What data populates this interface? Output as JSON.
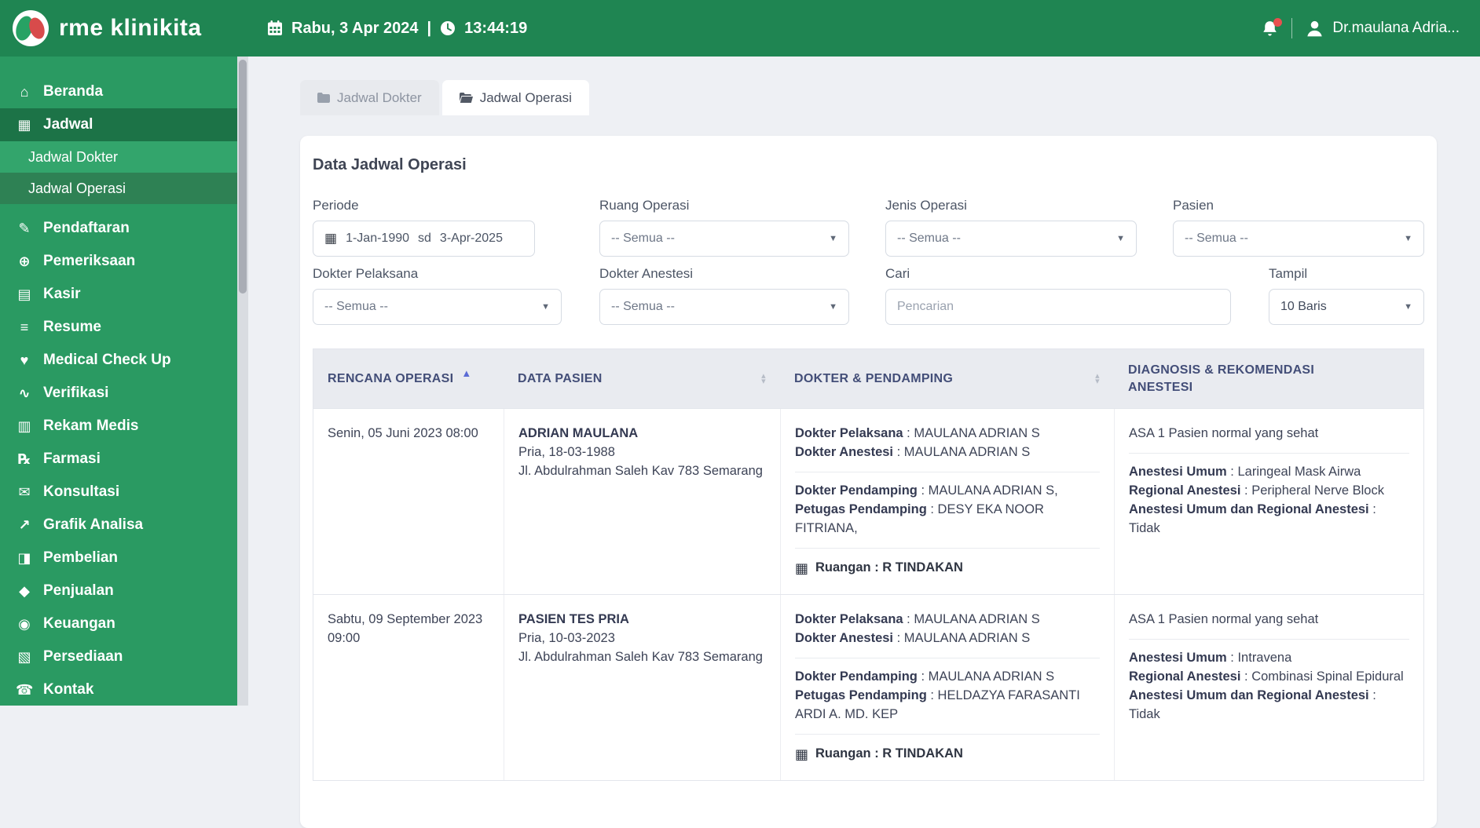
{
  "brand": {
    "name": "rme klinikita"
  },
  "topbar": {
    "date": "Rabu, 3 Apr 2024",
    "separator": "|",
    "time": "13:44:19",
    "user": "Dr.maulana Adria..."
  },
  "icons": {
    "home": "⌂",
    "calendar": "▦",
    "registration": "✎",
    "examination": "⊕",
    "cashier": "▤",
    "resume": "≡",
    "medical_check": "♥",
    "verification": "∿",
    "medical_record": "▥",
    "pharmacy": "℞",
    "consultation": "✉",
    "chart": "↗",
    "purchase": "◨",
    "sales": "◆",
    "finance": "◉",
    "inventory": "▧",
    "contact": "☎",
    "room": "▦",
    "calendar_input": "▦",
    "sort_asc": "▲",
    "sort_up": "▴",
    "sort_down": "▾",
    "caret_down": "▼"
  },
  "sidebar": {
    "items": [
      {
        "label": "Beranda"
      },
      {
        "label": "Jadwal"
      },
      {
        "label": "Jadwal Dokter"
      },
      {
        "label": "Jadwal Operasi"
      },
      {
        "label": "Pendaftaran"
      },
      {
        "label": "Pemeriksaan"
      },
      {
        "label": "Kasir"
      },
      {
        "label": "Resume"
      },
      {
        "label": "Medical Check Up"
      },
      {
        "label": "Verifikasi"
      },
      {
        "label": "Rekam Medis"
      },
      {
        "label": "Farmasi"
      },
      {
        "label": "Konsultasi"
      },
      {
        "label": "Grafik Analisa"
      },
      {
        "label": "Pembelian"
      },
      {
        "label": "Penjualan"
      },
      {
        "label": "Keuangan"
      },
      {
        "label": "Persediaan"
      },
      {
        "label": "Kontak"
      }
    ]
  },
  "tabs": [
    {
      "label": "Jadwal Dokter"
    },
    {
      "label": "Jadwal Operasi"
    }
  ],
  "panel": {
    "title": "Data Jadwal Operasi",
    "filters": {
      "periode": {
        "label": "Periode",
        "from": "1-Jan-1990",
        "separator": "sd",
        "to": "3-Apr-2025"
      },
      "ruang_operasi": {
        "label": "Ruang Operasi",
        "value": "-- Semua --"
      },
      "jenis_operasi": {
        "label": "Jenis Operasi",
        "value": "-- Semua --"
      },
      "pasien": {
        "label": "Pasien",
        "value": "-- Semua --"
      },
      "dokter_pelaksana": {
        "label": "Dokter Pelaksana",
        "value": "-- Semua --"
      },
      "dokter_anestesi": {
        "label": "Dokter Anestesi",
        "value": "-- Semua --"
      },
      "cari": {
        "label": "Cari",
        "placeholder": "Pencarian"
      },
      "tampil": {
        "label": "Tampil",
        "value": "10 Baris"
      }
    },
    "table": {
      "headers": [
        "RENCANA OPERASI",
        "DATA PASIEN",
        "DOKTER & PENDAMPING",
        "DIAGNOSIS & REKOMENDASI ANESTESI"
      ],
      "labels": {
        "colon": " : ",
        "dokter_pelaksana": "Dokter Pelaksana",
        "dokter_anestesi": "Dokter Anestesi",
        "dokter_pendamping": "Dokter Pendamping",
        "petugas_pendamping": "Petugas Pendamping",
        "ruangan": "Ruangan",
        "anestesi_umum": "Anestesi Umum",
        "regional_anestesi": "Regional Anestesi",
        "umum_dan_regional": "Anestesi Umum dan Regional Anestesi"
      },
      "rows": [
        {
          "rencana": "Senin, 05 Juni 2023 08:00",
          "pasien_nama": "ADRIAN MAULANA",
          "pasien_detail": "Pria, 18-03-1988",
          "pasien_alamat": "Jl. Abdulrahman Saleh Kav 783 Semarang",
          "dokter_pelaksana": "MAULANA ADRIAN S",
          "dokter_anestesi": "MAULANA ADRIAN S",
          "dokter_pendamping": "MAULANA ADRIAN S,",
          "petugas_pendamping": "DESY EKA NOOR FITRIANA,",
          "ruangan": "R TINDAKAN",
          "asa": "ASA 1 Pasien normal yang sehat",
          "anestesi_umum": "Laringeal Mask Airwa",
          "regional_anestesi": "Peripheral Nerve Block",
          "umum_dan_regional": "Tidak"
        },
        {
          "rencana": "Sabtu, 09 September 2023 09:00",
          "pasien_nama": "PASIEN TES PRIA",
          "pasien_detail": "Pria, 10-03-2023",
          "pasien_alamat": "Jl. Abdulrahman Saleh Kav 783 Semarang",
          "dokter_pelaksana": "MAULANA ADRIAN S",
          "dokter_anestesi": "MAULANA ADRIAN S",
          "dokter_pendamping": "MAULANA ADRIAN S",
          "petugas_pendamping": "HELDAZYA FARASANTI ARDI A. MD. KEP",
          "ruangan": "R TINDAKAN",
          "asa": "ASA 1 Pasien normal yang sehat",
          "anestesi_umum": "Intravena",
          "regional_anestesi": "Combinasi Spinal Epidural",
          "umum_dan_regional": "Tidak"
        }
      ]
    }
  }
}
